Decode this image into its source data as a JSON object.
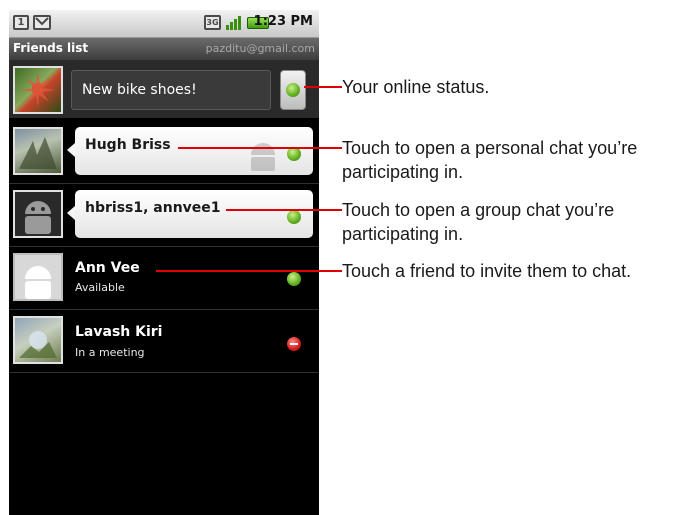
{
  "statusbar": {
    "sim_icon": "1",
    "gmail_icon": "gmail-icon",
    "network_label": "3G",
    "signal_icon": "signal-bars-icon",
    "battery_icon": "battery-icon",
    "time": "1:23 PM"
  },
  "titlebar": {
    "title": "Friends list",
    "account": "pazditu@gmail.com"
  },
  "my_status": {
    "message": "New bike shoes!",
    "status": "online"
  },
  "friends": [
    {
      "name": "Hugh Briss",
      "status": "available",
      "in_chat": true
    },
    {
      "name": "hbriss1, annvee1",
      "status": "available",
      "in_chat": true,
      "group": true
    },
    {
      "name": "Ann Vee",
      "sub": "Available",
      "status": "available"
    },
    {
      "name": "Lavash Kiri",
      "sub": "In a meeting",
      "status": "busy"
    }
  ],
  "callouts": [
    "Your online status.",
    "Touch to open a personal chat you’re participating in.",
    "Touch to open a group chat you’re participating in.",
    "Touch a friend to invite them to chat."
  ],
  "colors": {
    "callout_red": "#e00000",
    "online_green": "#5fae1e",
    "busy_red": "#d21d1d"
  }
}
